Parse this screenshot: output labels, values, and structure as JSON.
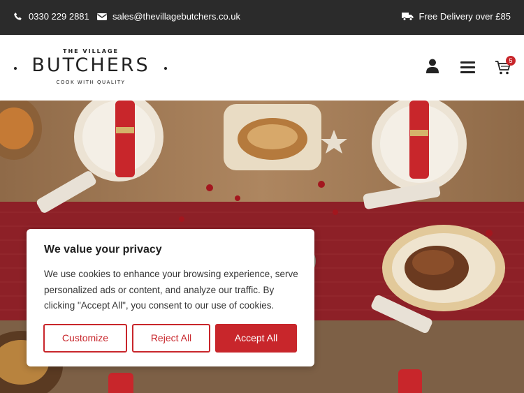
{
  "topbar": {
    "phone": "0330 229 2881",
    "email": "sales@thevillagebutchers.co.uk",
    "delivery": "Free Delivery over £85",
    "icons": [
      "phone-icon",
      "envelope-icon",
      "truck-icon"
    ]
  },
  "logo": {
    "top_text": "THE VILLAGE",
    "main_text": "BUTCHERS",
    "tagline": "COOK WITH QUALITY"
  },
  "header": {
    "icons": [
      "user-icon",
      "menu-icon",
      "cart-icon"
    ],
    "cart_count": "5"
  },
  "cookie_banner": {
    "title": "We value your privacy",
    "text": "We use cookies to enhance your browsing experience, serve personalized ads or content, and analyze our traffic. By clicking \"Accept All\", you consent to our use of cookies.",
    "customize_label": "Customize",
    "reject_label": "Reject All",
    "accept_label": "Accept All"
  },
  "colors": {
    "topbar_bg": "#2b2b2b",
    "accent": "#c8262b",
    "text_dark": "#212121"
  }
}
